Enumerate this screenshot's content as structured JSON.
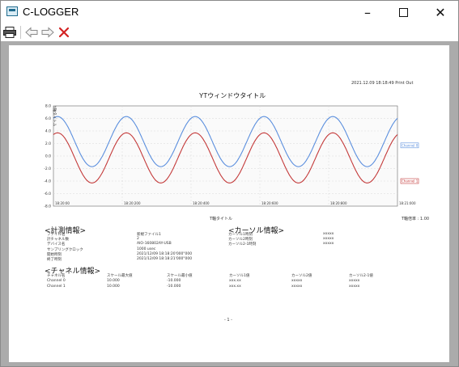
{
  "window": {
    "title": "C-LOGGER",
    "minimize_icon": "minimize-icon",
    "maximize_icon": "maximize-icon",
    "close_icon": "close-icon"
  },
  "toolbar": {
    "print_icon": "printer-icon",
    "back_icon": "back-arrow-icon",
    "forward_icon": "forward-arrow-icon",
    "close_icon": "red-x-icon"
  },
  "report": {
    "print_out": "2021.12.09 18:18:49 Print Out",
    "chart_title": "YTウィンドウタイトル",
    "x_title": "T軸タイトル",
    "y_title": "Y軸タイトル",
    "magnification": "T軸倍率 : 1.00",
    "page_number": "- 1 -",
    "measurement": {
      "heading": "<計測情報>",
      "rows": [
        {
          "label": "ファイル名",
          "value": "新規ファイル1"
        },
        {
          "label": "計チャネル数",
          "value": "2"
        },
        {
          "label": "デバイス名",
          "value": "AIO-160802AY-USB"
        },
        {
          "label": "サンプリングクロック",
          "value": "1000 usec"
        },
        {
          "label": "開始時刻",
          "value": "2021/12/09 18:18:20'000\"000"
        },
        {
          "label": "終了時刻",
          "value": "2021/12/09 18:18:21'000\"000"
        }
      ]
    },
    "cursor": {
      "heading": "<カーソル情報>",
      "rows": [
        {
          "label": "カーソル1時刻",
          "value": "xxxxx"
        },
        {
          "label": "カーソル2時刻",
          "value": "xxxxx"
        },
        {
          "label": "カーソル2-1時刻",
          "value": "xxxxx"
        }
      ]
    },
    "channel": {
      "heading": "<チャネル情報>",
      "headers": [
        "チャネル名",
        "スケール最大値",
        "スケール最小値",
        "カーソル1値",
        "カーソル2値",
        "カーソル2-1値"
      ],
      "rows": [
        [
          "Channel 0",
          "10.000",
          "-10.000",
          "xxx.xx",
          "xxxxx",
          "xxxxx"
        ],
        [
          "Channel 1",
          "10.000",
          "-10.000",
          "xxx.xx",
          "xxxxx",
          "xxxxx"
        ]
      ]
    }
  },
  "chart_data": {
    "type": "line",
    "title": "YTウィンドウタイトル",
    "xlabel": "T軸タイトル",
    "ylabel": "Y軸タイトル",
    "ylim": [
      -8.0,
      8.0
    ],
    "y_ticks": [
      "8.0",
      "6.0",
      "4.0",
      "2.0",
      "0.0",
      "-2.0",
      "-4.0",
      "-6.0",
      "-8.0"
    ],
    "x_ticks": [
      "18:18:20'000\"000",
      "18:18:20'200\"000",
      "18:18:20'400\"000",
      "18:18:20'600\"000",
      "18:18:20'800\"000",
      "18:18:21'000\"000"
    ],
    "x_tick_labels": [
      "18:20:00",
      "18:20:200",
      "18:20:400",
      "18:20:600",
      "18:20:800",
      "18:21:000"
    ],
    "grid": true,
    "cycles": 5,
    "series": [
      {
        "name": "Channel 0",
        "color": "#5b8fde",
        "center": 2.3,
        "amplitude": 4.0,
        "end_value": 1.7
      },
      {
        "name": "Channel 1",
        "color": "#c43a3a",
        "center": -0.3,
        "amplitude": 4.0,
        "end_value": -4.0
      }
    ]
  }
}
